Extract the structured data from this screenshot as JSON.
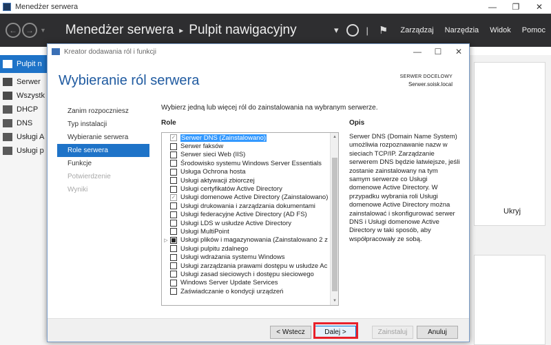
{
  "window": {
    "title": "Menedżer serwera",
    "controls": [
      "—",
      "❐",
      "✕"
    ]
  },
  "header": {
    "breadcrumb_root": "Menedżer serwera",
    "breadcrumb_separator": "▸",
    "breadcrumb_page": "Pulpit nawigacyjny",
    "menus": [
      "Zarządzaj",
      "Narzędzia",
      "Widok",
      "Pomoc"
    ]
  },
  "sidebar": {
    "items": [
      {
        "label": "Pulpit n",
        "icon": "dashboard-icon",
        "active": true
      },
      {
        "label": "Serwer",
        "icon": "server-icon",
        "active": false
      },
      {
        "label": "Wszystk",
        "icon": "servers-icon",
        "active": false
      },
      {
        "label": "DHCP",
        "icon": "dhcp-icon",
        "active": false
      },
      {
        "label": "DNS",
        "icon": "dns-icon",
        "active": false
      },
      {
        "label": "Usługi A",
        "icon": "ad-icon",
        "active": false
      },
      {
        "label": "Usługi p",
        "icon": "file-services-icon",
        "active": false
      }
    ]
  },
  "main": {
    "hide_label": "Ukryj"
  },
  "wizard": {
    "title": "Kreator dodawania ról i funkcji",
    "controls": [
      "—",
      "☐",
      "✕"
    ],
    "heading": "Wybieranie ról serwera",
    "target_label": "SERWER DOCELOWY",
    "target_server": "Serwer.soisk.local",
    "steps": [
      {
        "label": "Zanim rozpoczniesz",
        "state": "normal"
      },
      {
        "label": "Typ instalacji",
        "state": "normal"
      },
      {
        "label": "Wybieranie serwera",
        "state": "normal"
      },
      {
        "label": "Role serwera",
        "state": "active"
      },
      {
        "label": "Funkcje",
        "state": "normal"
      },
      {
        "label": "Potwierdzenie",
        "state": "disabled"
      },
      {
        "label": "Wyniki",
        "state": "disabled"
      }
    ],
    "intro": "Wybierz jedną lub więcej ról do zainstalowania na wybranym serwerze.",
    "roles_label": "Role",
    "description_label": "Opis",
    "roles": [
      {
        "name": "Serwer DNS (Zainstalowano)",
        "state": "checked-grey",
        "selected": true,
        "expandable": false
      },
      {
        "name": "Serwer faksów",
        "state": "unchecked",
        "selected": false,
        "expandable": false
      },
      {
        "name": "Serwer sieci Web (IIS)",
        "state": "unchecked",
        "selected": false,
        "expandable": false
      },
      {
        "name": "Środowisko systemu Windows Server Essentials",
        "state": "unchecked",
        "selected": false,
        "expandable": false
      },
      {
        "name": "Usługa Ochrona hosta",
        "state": "unchecked",
        "selected": false,
        "expandable": false
      },
      {
        "name": "Usługi aktywacji zbiorczej",
        "state": "unchecked",
        "selected": false,
        "expandable": false
      },
      {
        "name": "Usługi certyfikatów Active Directory",
        "state": "unchecked",
        "selected": false,
        "expandable": false
      },
      {
        "name": "Usługi domenowe Active Directory (Zainstalowano)",
        "state": "checked-grey",
        "selected": false,
        "expandable": false
      },
      {
        "name": "Usługi drukowania i zarządzania dokumentami",
        "state": "unchecked",
        "selected": false,
        "expandable": false
      },
      {
        "name": "Usługi federacyjne Active Directory (AD FS)",
        "state": "unchecked",
        "selected": false,
        "expandable": false
      },
      {
        "name": "Usługi LDS w usłudze Active Directory",
        "state": "unchecked",
        "selected": false,
        "expandable": false
      },
      {
        "name": "Usługi MultiPoint",
        "state": "unchecked",
        "selected": false,
        "expandable": false
      },
      {
        "name": "Usługi plików i magazynowania (Zainstalowano 2 z",
        "state": "partial",
        "selected": false,
        "expandable": true
      },
      {
        "name": "Usługi pulpitu zdalnego",
        "state": "unchecked",
        "selected": false,
        "expandable": false
      },
      {
        "name": "Usługi wdrażania systemu Windows",
        "state": "unchecked",
        "selected": false,
        "expandable": false
      },
      {
        "name": "Usługi zarządzania prawami dostępu w usłudze Ac",
        "state": "unchecked",
        "selected": false,
        "expandable": false
      },
      {
        "name": "Usługi zasad sieciowych i dostępu sieciowego",
        "state": "unchecked",
        "selected": false,
        "expandable": false
      },
      {
        "name": "Windows Server Update Services",
        "state": "unchecked",
        "selected": false,
        "expandable": false
      },
      {
        "name": "Zaświadczanie o kondycji urządzeń",
        "state": "unchecked",
        "selected": false,
        "expandable": false
      }
    ],
    "description": "Serwer DNS (Domain Name System) umożliwia rozpoznawanie nazw w sieciach TCP/IP. Zarządzanie serwerem DNS będzie łatwiejsze, jeśli zostanie zainstalowany na tym samym serwerze co Usługi domenowe Active Directory. W przypadku wybrania roli Usługi domenowe Active Directory można zainstalować i skonfigurować serwer DNS i Usługi domenowe Active Directory w taki sposób, aby współpracowały ze sobą.",
    "buttons": {
      "back": "< Wstecz",
      "next": "Dalej >",
      "install": "Zainstaluj",
      "cancel": "Anuluj"
    }
  },
  "colors": {
    "accent": "#1e73c8",
    "header_bg": "#2e2e30",
    "heading": "#1f5aa0",
    "highlight": "#e8202a"
  }
}
